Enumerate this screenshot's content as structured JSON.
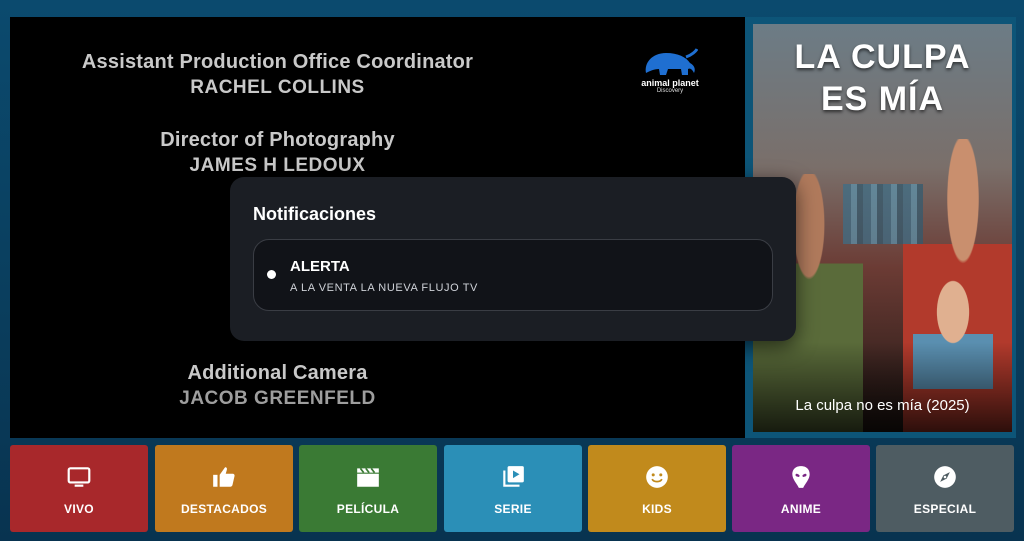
{
  "player": {
    "credits": [
      {
        "role": "Assistant Production Office Coordinator",
        "person": "RACHEL COLLINS"
      },
      {
        "role": "Director of Photography",
        "person": "JAMES H LEDOUX"
      },
      {
        "role": "Additional Camera",
        "person": "JACOB GREENFELD"
      }
    ],
    "channel_logo": {
      "name": "animal planet",
      "sub": "Discovery",
      "icon": "elephant-logo-icon"
    }
  },
  "poster": {
    "title_art_line1": "LA CULPA",
    "title_art_line2": "ES MÍA",
    "caption": "La culpa no es mía (2025)"
  },
  "notifications": {
    "heading": "Notificaciones",
    "items": [
      {
        "title": "ALERTA",
        "body": "A LA VENTA LA NUEVA FLUJO TV"
      }
    ]
  },
  "menu": [
    {
      "label": "VIVO",
      "icon": "tv-icon",
      "color": "#a8282b"
    },
    {
      "label": "DESTACADOS",
      "icon": "thumbs-up-icon",
      "color": "#c0791e"
    },
    {
      "label": "PELÍCULA",
      "icon": "clapperboard-icon",
      "color": "#3a7a34"
    },
    {
      "label": "SERIE",
      "icon": "video-library-icon",
      "color": "#2b8fb7"
    },
    {
      "label": "KIDS",
      "icon": "smiley-icon",
      "color": "#c18a1c"
    },
    {
      "label": "ANIME",
      "icon": "alien-icon",
      "color": "#7a2784"
    },
    {
      "label": "ESPECIAL",
      "icon": "compass-icon",
      "color": "#4e5c62"
    }
  ]
}
